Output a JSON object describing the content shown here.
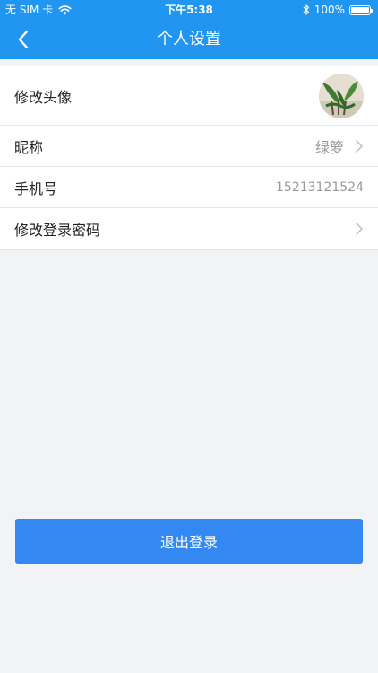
{
  "status_bar": {
    "carrier": "无 SIM 卡",
    "time": "下午5:38",
    "battery": "100%"
  },
  "nav": {
    "title": "个人设置",
    "back_icon": "chevron-left-icon"
  },
  "settings": {
    "avatar_label": "修改头像",
    "nickname_label": "昵称",
    "nickname_value": "绿箩",
    "phone_label": "手机号",
    "phone_value": "15213121524",
    "password_label": "修改登录密码"
  },
  "logout_label": "退出登录",
  "colors": {
    "header": "#2196f0",
    "button": "#3388f2",
    "background": "#f2f3f5"
  }
}
